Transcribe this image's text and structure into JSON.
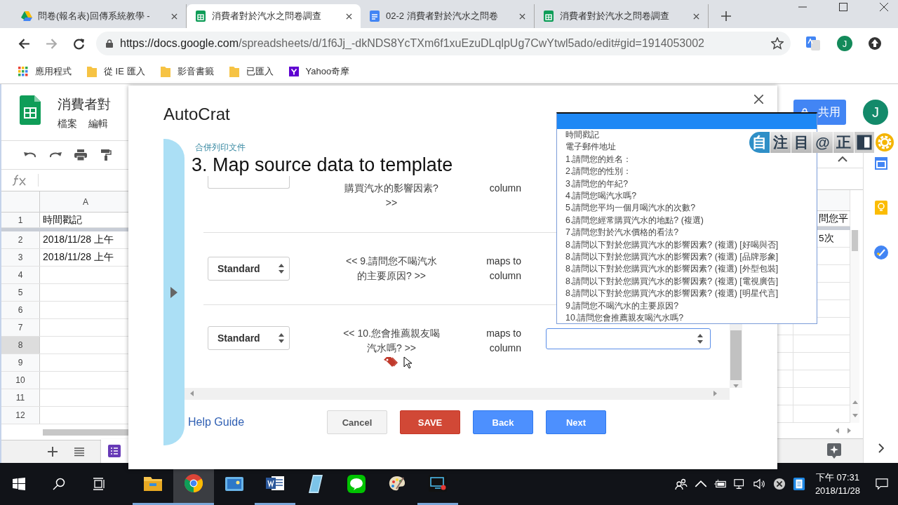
{
  "browser": {
    "tabs": [
      {
        "title": "問卷(報名表)回傳系統教學 -",
        "kind": "drive",
        "selected": false
      },
      {
        "title": "消費者對於汽水之問卷調查",
        "kind": "sheets",
        "selected": true
      },
      {
        "title": "02-2 消費者對於汽水之問卷",
        "kind": "docs",
        "selected": false
      },
      {
        "title": "消費者對於汽水之問卷調查",
        "kind": "sheets",
        "selected": false
      }
    ],
    "url_host": "https://docs.google.com",
    "url_path": "/spreadsheets/d/1f6Jj_-dkNDS8YcTXm6f1xuEzuDLqlpUg7CwYtwl5ado/edit#gid=1914053002",
    "profile_initial": "J",
    "bookmarks": [
      {
        "label": "應用程式",
        "kind": "apps"
      },
      {
        "label": "從 IE 匯入",
        "kind": "folder"
      },
      {
        "label": "影音書籤",
        "kind": "folder"
      },
      {
        "label": "已匯入",
        "kind": "folder"
      },
      {
        "label": "Yahoo奇摩",
        "kind": "yahoo"
      }
    ]
  },
  "sheet": {
    "title": "消費者對",
    "menu": [
      "檔案",
      "編輯"
    ],
    "column_header": "A",
    "share_label": "共用",
    "avatar_initial": "J",
    "rows": [
      {
        "number": "1",
        "column_a": "時間戳記",
        "column_far": "問您平",
        "selected": false
      },
      {
        "number": "2",
        "column_a": "2018/11/28 上午",
        "column_far": "5次",
        "selected": false
      },
      {
        "number": "3",
        "column_a": "2018/11/28 上午",
        "selected": false
      },
      {
        "number": "4",
        "selected": false
      },
      {
        "number": "5",
        "selected": false
      },
      {
        "number": "6",
        "selected": false
      },
      {
        "number": "7",
        "selected": false
      },
      {
        "number": "8",
        "selected": true
      },
      {
        "number": "9",
        "selected": false
      },
      {
        "number": "10",
        "selected": false
      },
      {
        "number": "11",
        "selected": false
      },
      {
        "number": "12",
        "selected": false
      }
    ]
  },
  "dialog": {
    "title": "AutoCrat",
    "subtitle": "合併列印文件",
    "heading": "3. Map source data to template",
    "mappings": [
      {
        "kind": "partial",
        "tag_lines": [
          "購買汽水的影響因素?",
          ">>"
        ],
        "map_lines": [
          "column"
        ],
        "hovered": false
      },
      {
        "kind": "full",
        "mode": "Standard",
        "tag_lines": [
          "<< 9.請問您不喝汽水",
          "的主要原因? >>"
        ],
        "map_lines": [
          "maps to",
          "column"
        ],
        "hovered": false
      },
      {
        "kind": "full",
        "mode": "Standard",
        "tag_lines": [
          "<< 10.您會推薦親友喝",
          "汽水嗎? >>"
        ],
        "map_lines": [
          "maps to",
          "column"
        ],
        "hovered": true
      }
    ],
    "help_link": "Help Guide",
    "buttons": [
      {
        "label": "Cancel",
        "kind": "cancel"
      },
      {
        "label": "SAVE",
        "kind": "save"
      },
      {
        "label": "Back",
        "kind": "primary"
      },
      {
        "label": "Next",
        "kind": "primary"
      }
    ]
  },
  "column_dropdown": {
    "blank_option_selected": true,
    "options": [
      "時間戳記",
      "電子郵件地址",
      "1.請問您的姓名：",
      "2.請問您的性別：",
      "3.請問您的年紀?",
      "4.請問您喝汽水嗎?",
      "5.請問您平均一個月喝汽水的次數?",
      "6.請問您經常購買汽水的地點? (複選)",
      "7.請問您對於汽水價格的看法?",
      "8.請問以下對於您購買汽水的影響因素? (複選) [好喝與否]",
      "8.請問以下對於您購買汽水的影響因素? (複選) [品牌形象]",
      "8.請問以下對於您購買汽水的影響因素? (複選) [外型包裝]",
      "8.請問以下對於您購買汽水的影響因素? (複選) [電視廣告]",
      "8.請問以下對於您購買汽水的影響因素? (複選) [明星代言]",
      "9.請問您不喝汽水的主要原因?",
      "10.請問您會推薦親友喝汽水嗎?"
    ]
  },
  "floating_toolbar": {
    "chars": [
      "自",
      "注",
      "目",
      "@",
      "正"
    ]
  },
  "taskbar": {
    "apps": [
      {
        "kind": "explorer",
        "running": true,
        "selected": false
      },
      {
        "kind": "chrome",
        "running": true,
        "selected": true
      },
      {
        "kind": "photos",
        "running": false,
        "selected": false
      },
      {
        "kind": "word",
        "running": true,
        "selected": false
      },
      {
        "kind": "notepad",
        "running": false,
        "selected": false
      },
      {
        "kind": "line",
        "running": false,
        "selected": false
      },
      {
        "kind": "paint",
        "running": false,
        "selected": false
      },
      {
        "kind": "recorder",
        "running": true,
        "selected": false
      }
    ],
    "time": "下午 07:31",
    "date": "2018/11/28"
  }
}
